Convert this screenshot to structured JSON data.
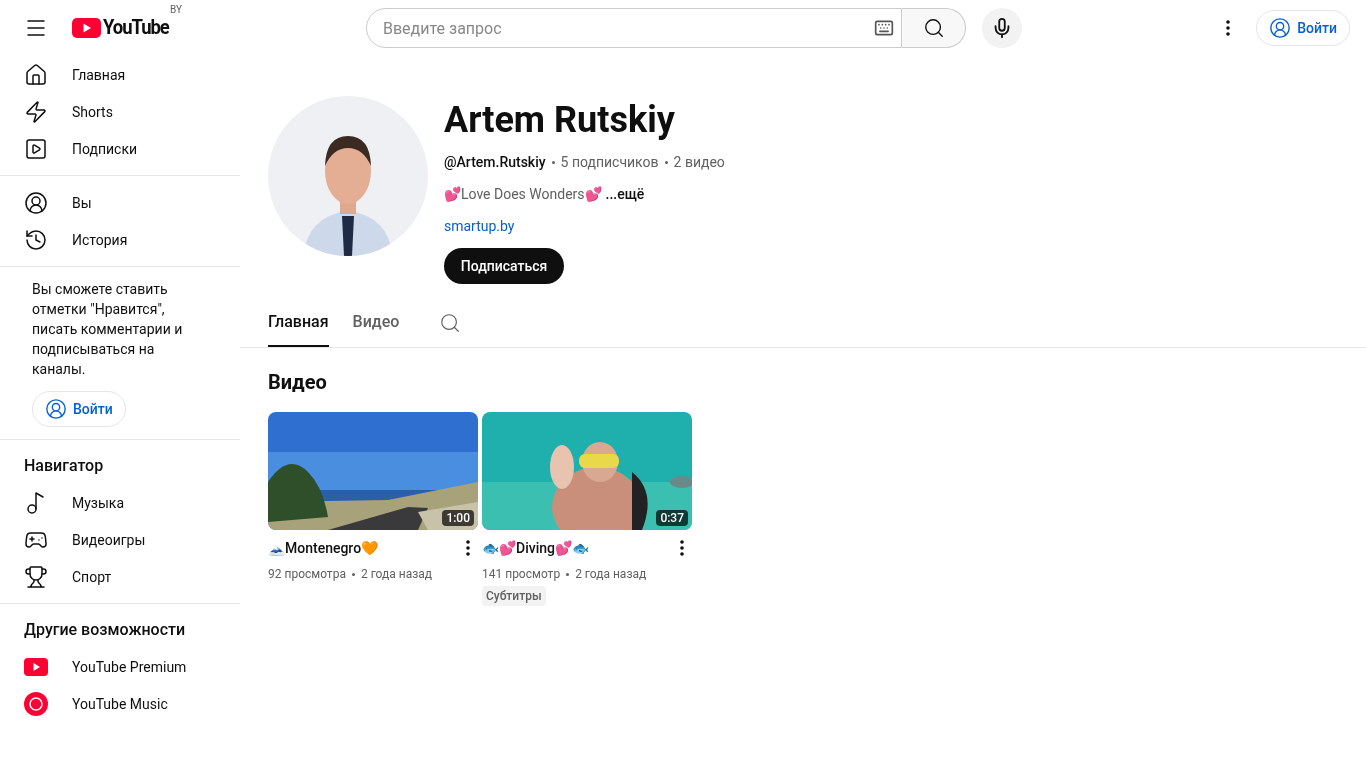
{
  "topbar": {
    "logo": "YouTube",
    "country": "BY",
    "search_placeholder": "Введите запрос",
    "signin": "Войти"
  },
  "sidebar": {
    "sections": [
      {
        "items": [
          {
            "label": "Главная",
            "selected": false
          },
          {
            "label": "Shorts",
            "selected": false
          },
          {
            "label": "Подписки",
            "selected": false
          }
        ]
      },
      {
        "items": [
          {
            "label": "Вы",
            "selected": false
          },
          {
            "label": "История",
            "selected": false
          }
        ]
      },
      {
        "heading": "Навигатор",
        "items": [
          {
            "label": "Музыка",
            "selected": false
          },
          {
            "label": "Видеоигры",
            "selected": false
          },
          {
            "label": "Спорт",
            "selected": false
          }
        ]
      },
      {
        "heading": "Другие возможности",
        "items": [
          {
            "label": "YouTube Premium",
            "selected": false
          },
          {
            "label": "YouTube Music",
            "selected": false
          }
        ]
      }
    ],
    "promo": {
      "text": "Вы сможете ставить отметки \"Нравится\", писать комментарии и подписываться на каналы.",
      "button": "Войти"
    }
  },
  "channel": {
    "name": "Artem Rutskiy",
    "handle": "@Artem.Rutskiy",
    "subscribers": "5 подписчиков",
    "videos": "2 видео",
    "description": "💕Love Does Wonders💕",
    "more": "...ещё",
    "link": "smartup.by",
    "subscribe": "Подписаться"
  },
  "tabs": [
    {
      "label": "Главная",
      "selected": true
    },
    {
      "label": "Видео",
      "selected": false
    }
  ],
  "section_title": "Видео",
  "videos": [
    {
      "title": "🗻Montenegro🧡",
      "duration": "1:00",
      "views": "92 просмотра",
      "age": "2 года назад"
    },
    {
      "title": "🐟💕Diving💕🐟",
      "duration": "0:37",
      "views": "141 просмотр",
      "age": "2 года назад",
      "badge": "Субтитры"
    }
  ]
}
